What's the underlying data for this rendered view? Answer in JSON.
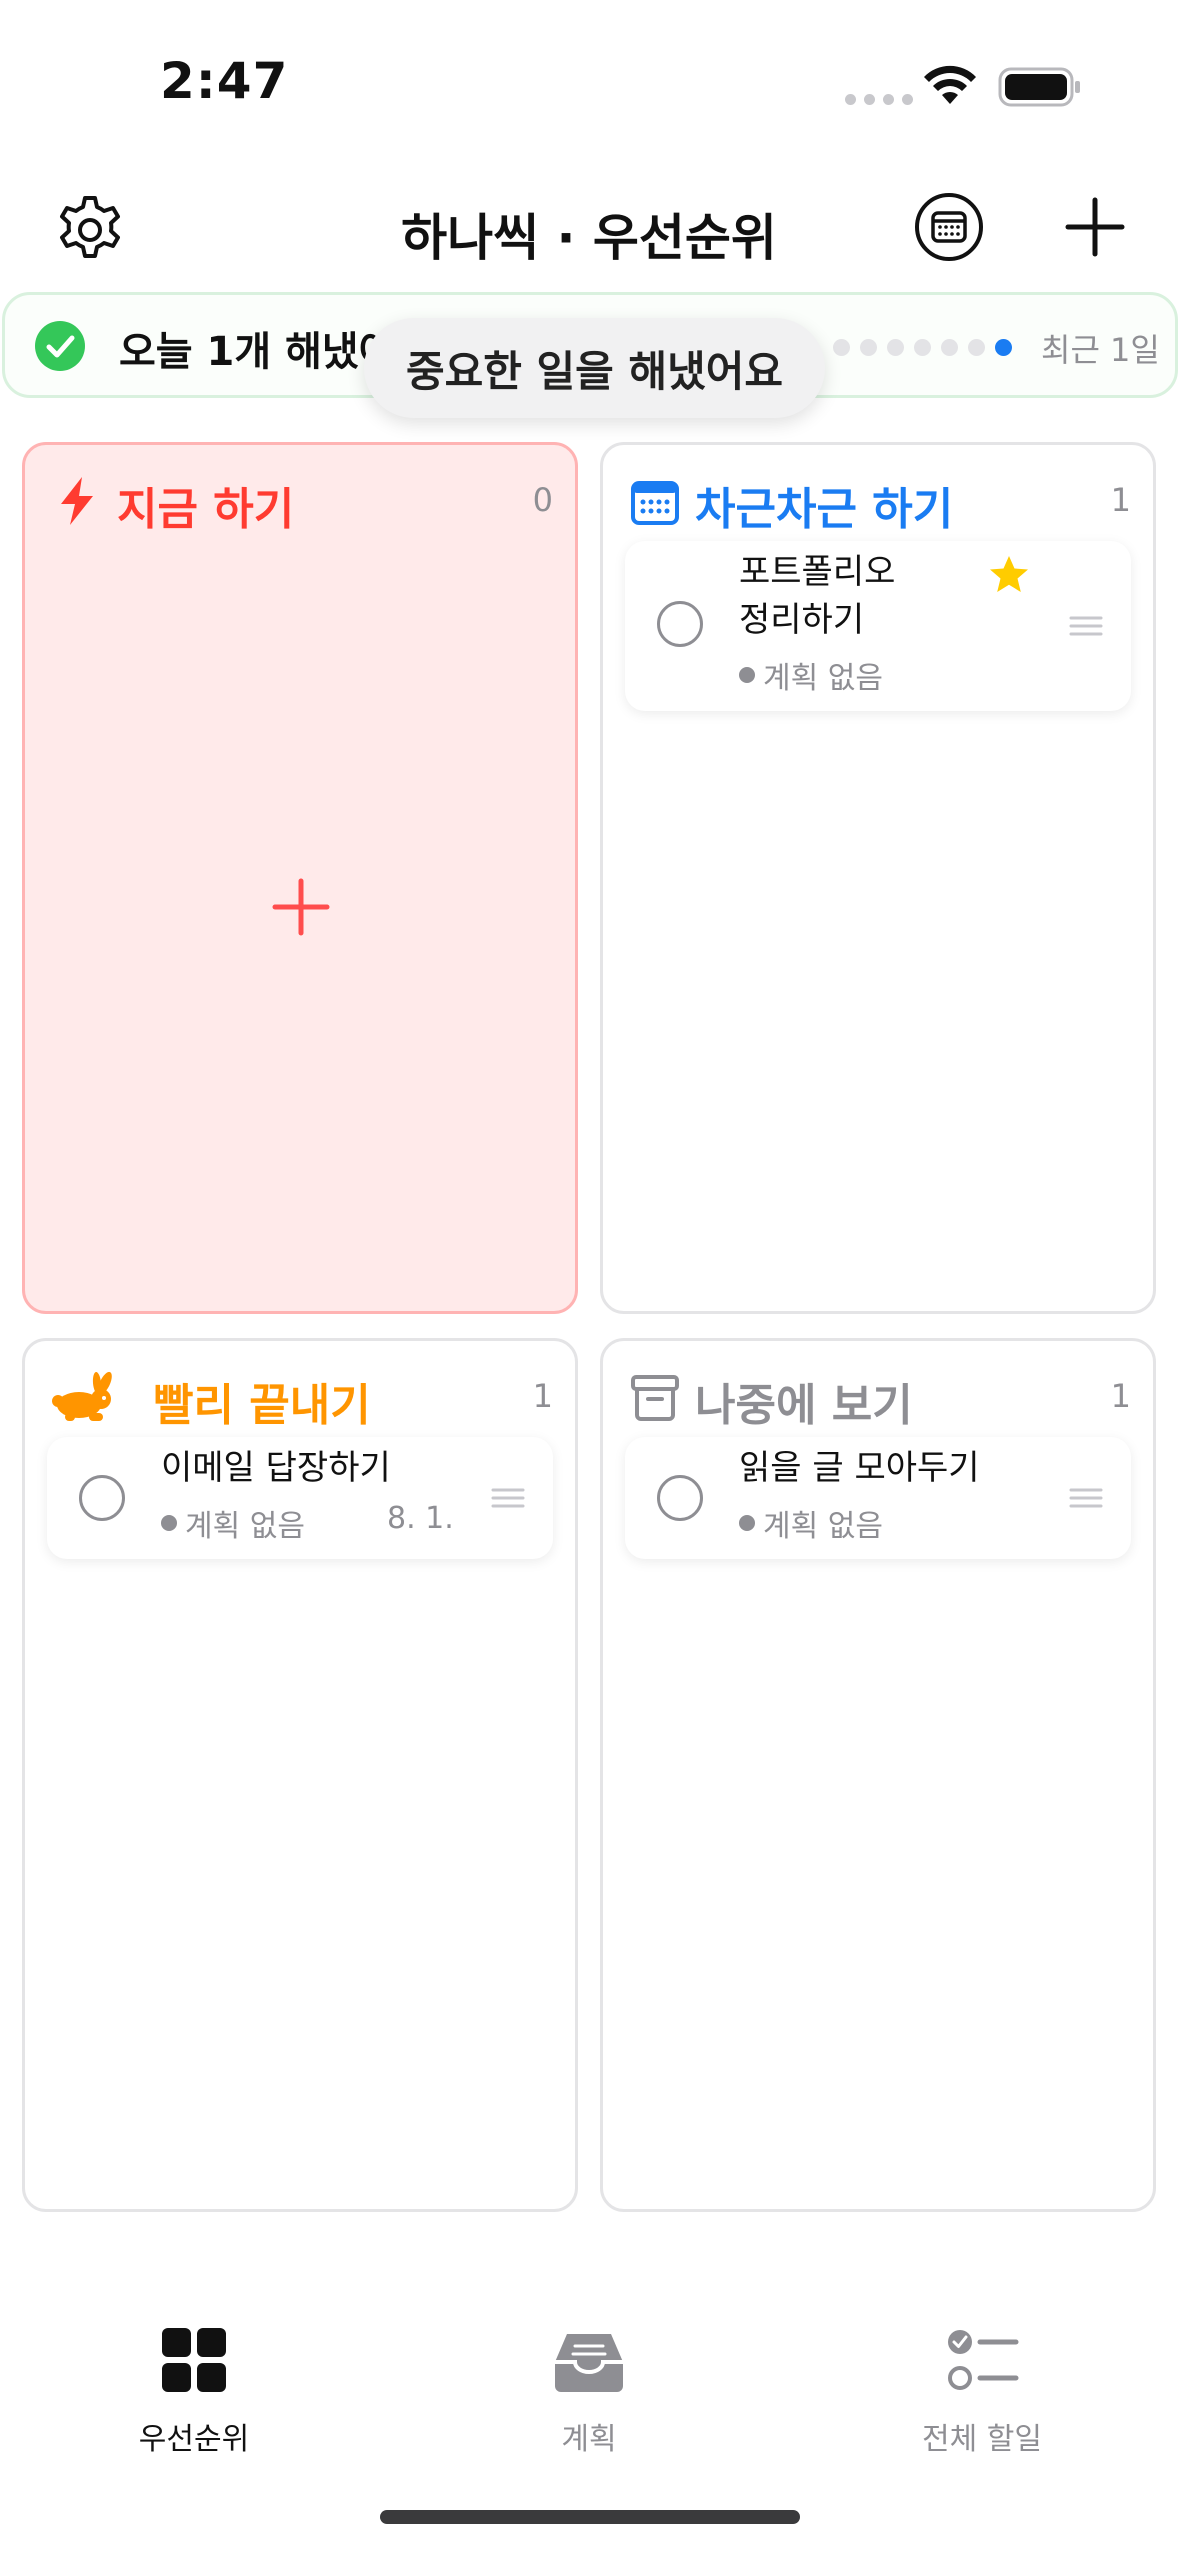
{
  "status_bar": {
    "time": "2:47"
  },
  "header": {
    "title": "하나씩 · 우선순위",
    "settings_icon": "gear-icon",
    "calendar_icon": "calendar-icon",
    "add_icon": "plus-icon"
  },
  "progress_banner": {
    "text": "오늘 1개 해냈어요",
    "recent_label": "최근 1일",
    "dots_total": 7,
    "dots_active": 1,
    "accent": "#34c759"
  },
  "toast": {
    "text": "중요한 일을 해냈어요"
  },
  "quadrants": {
    "now": {
      "title": "지금 하기",
      "count": "0",
      "color": "#ff3b30",
      "icon": "bolt-icon"
    },
    "steady": {
      "title": "차근차근 하기",
      "count": "1",
      "color": "#1a7cf2",
      "icon": "calendar-icon",
      "tasks": [
        {
          "title_line1": "포트폴리오",
          "title_line2": "정리하기",
          "meta": "계획 없음",
          "starred": true
        }
      ]
    },
    "quick": {
      "title": "빨리 끝내기",
      "count": "1",
      "color": "#ff9500",
      "icon": "rabbit-icon",
      "tasks": [
        {
          "title": "이메일 답장하기",
          "meta": "계획 없음",
          "date": "8. 1."
        }
      ]
    },
    "later": {
      "title": "나중에 보기",
      "count": "1",
      "color": "#8e8e93",
      "icon": "archive-box-icon",
      "tasks": [
        {
          "title": "읽을 글 모아두기",
          "meta": "계획 없음"
        }
      ]
    }
  },
  "tab_bar": {
    "tabs": [
      {
        "label": "우선순위",
        "icon": "grid-icon",
        "active": true
      },
      {
        "label": "계획",
        "icon": "inbox-tray-icon",
        "active": false
      },
      {
        "label": "전체 할일",
        "icon": "checklist-icon",
        "active": false
      }
    ]
  }
}
